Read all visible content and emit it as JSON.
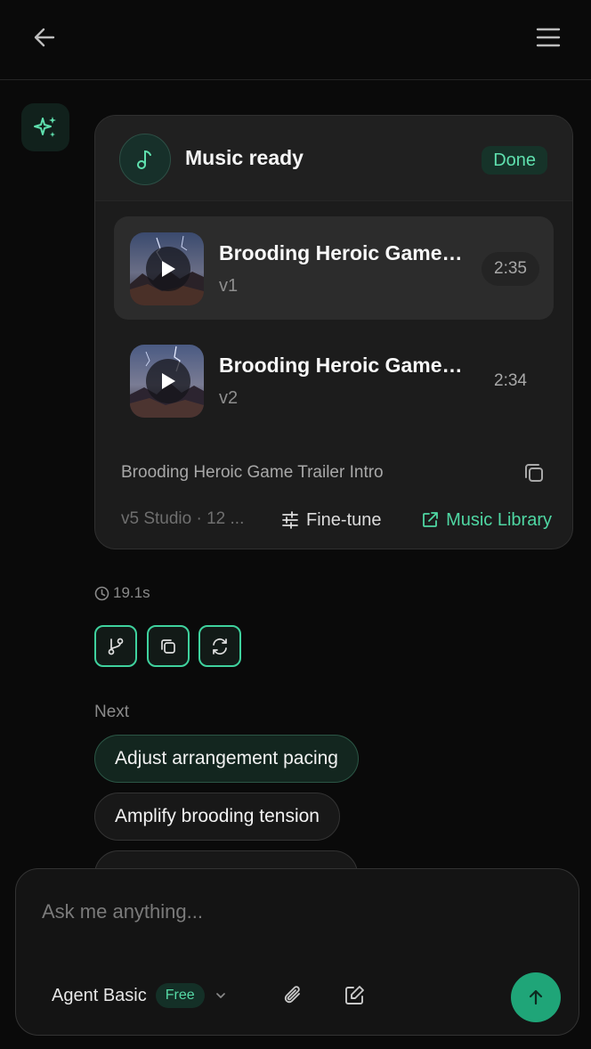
{
  "header": {
    "back_icon": "arrow-left-icon",
    "menu_icon": "hamburger-menu-icon"
  },
  "assistant": {
    "avatar_icon": "sparkles-icon"
  },
  "card": {
    "title": "Music ready",
    "status": "Done",
    "tracks": [
      {
        "name": "Brooding Heroic Game Trailer Intro",
        "version": "v1",
        "duration": "2:35"
      },
      {
        "name": "Brooding Heroic Game Trailer Intro",
        "version": "v2",
        "duration": "2:34"
      }
    ],
    "description": "Brooding Heroic Game Trailer Intro",
    "meta": "v5 Studio · 12 ...",
    "finetune_label": "Fine-tune",
    "library_label": "Music Library"
  },
  "response": {
    "duration": "19.1s"
  },
  "next": {
    "label": "Next",
    "suggestions": [
      "Adjust arrangement pacing",
      "Amplify brooding tension"
    ]
  },
  "composer": {
    "placeholder": "Ask me anything...",
    "agent_label": "Agent Basic",
    "agent_badge": "Free"
  },
  "colors": {
    "accent": "#3fd29e",
    "send_button": "#1fa578",
    "background": "#0a0a0a"
  }
}
